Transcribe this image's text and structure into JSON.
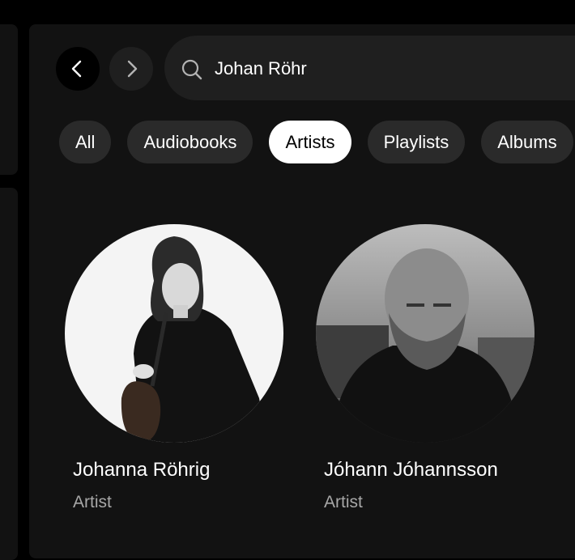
{
  "search": {
    "value": "Johan Röhr",
    "icon": "search-icon"
  },
  "navigation": {
    "back_icon": "chevron-left-icon",
    "forward_icon": "chevron-right-icon"
  },
  "filters": [
    {
      "label": "All",
      "active": false
    },
    {
      "label": "Audiobooks",
      "active": false
    },
    {
      "label": "Artists",
      "active": true
    },
    {
      "label": "Playlists",
      "active": false
    },
    {
      "label": "Albums",
      "active": false
    }
  ],
  "results": [
    {
      "name": "Johanna Röhrig",
      "type": "Artist"
    },
    {
      "name": "Jóhann Jóhannsson",
      "type": "Artist"
    }
  ],
  "colors": {
    "background": "#000000",
    "panel": "#121212",
    "chip": "#2a2a2a",
    "chip_active": "#ffffff",
    "muted_text": "#a7a7a7"
  }
}
